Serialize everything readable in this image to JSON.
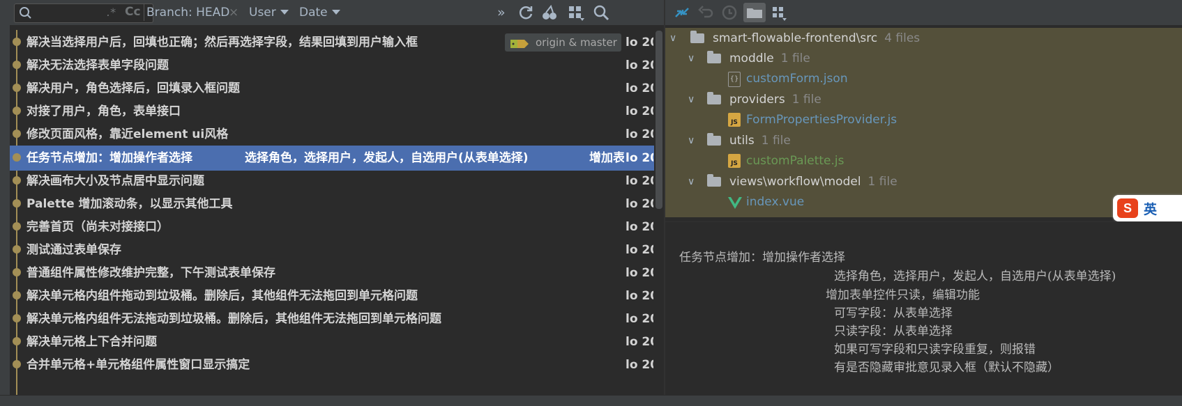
{
  "toolbar": {
    "search_placeholder": "",
    "regex_symbol": ".*",
    "case_symbol": "Cc",
    "branch_filter": "Branch: HEAD",
    "branch_clear": "×",
    "user_filter": "User",
    "date_filter": "Date",
    "more_symbol": "»"
  },
  "commits": [
    {
      "message": "解决当选择用户后，回填也正确；然后再选择字段，结果回填到用户输入框",
      "author": "lo 20",
      "ref": "origin & master"
    },
    {
      "message": "解决无法选择表单字段问题",
      "author": "lo 20"
    },
    {
      "message": "解决用户，角色选择后，回填录入框问题",
      "author": "lo 20"
    },
    {
      "message": "对接了用户，角色，表单接口",
      "author": "lo 20"
    },
    {
      "message": "修改页面风格，靠近element ui风格",
      "author": "lo 20"
    },
    {
      "message": "任务节点增加：增加操作者选择",
      "author": "lo 20",
      "selected": true,
      "extra1": "选择角色，选择用户，发起人，自选用户(从表单选择)",
      "extra2": "增加表"
    },
    {
      "message": "解决画布大小及节点居中显示问题",
      "author": "lo 20"
    },
    {
      "message": "Palette 增加滚动条，以显示其他工具",
      "author": "lo 20"
    },
    {
      "message": "完善首页（尚未对接接口）",
      "author": "lo 20"
    },
    {
      "message": "测试通过表单保存",
      "author": "lo 20"
    },
    {
      "message": "普通组件属性修改维护完整，下午测试表单保存",
      "author": "lo 20"
    },
    {
      "message": "解决单元格内组件拖动到垃圾桶。删除后，其他组件无法拖回到单元格问题",
      "author": "lo 20"
    },
    {
      "message": "解决单元格内组件无法拖动到垃圾桶。删除后，其他组件无法拖回到单元格问题",
      "author": "lo 20"
    },
    {
      "message": "解决单元格上下合并问题",
      "author": "lo 20"
    },
    {
      "message": "合并单元格+单元格组件属性窗口显示搞定",
      "author": "lo 20"
    }
  ],
  "tree": {
    "root": {
      "name": "smart-flowable-frontend\\src",
      "count": "4 files"
    },
    "folders": [
      {
        "name": "moddle",
        "count": "1 file",
        "file": "customForm.json"
      },
      {
        "name": "providers",
        "count": "1 file",
        "file": "FormPropertiesProvider.js"
      },
      {
        "name": "utils",
        "count": "1 file",
        "file": "customPalette.js"
      },
      {
        "name": "views\\workflow\\model",
        "count": "1 file",
        "file": "index.vue"
      }
    ]
  },
  "detail": {
    "lines": [
      "任务节点增加：增加操作者选择",
      "选择角色，选择用户，发起人，自选用户(从表单选择)",
      "增加表单控件只读，编辑功能",
      "可写字段：从表单选择",
      "只读字段：从表单选择",
      "如果可写字段和只读字段重复，则报错",
      "有是否隐藏审批意见录入框（默认不隐藏）"
    ]
  },
  "ime": {
    "label": "英"
  },
  "colors": {
    "background": "#2b2b2b",
    "toolbar": "#3c3f41",
    "selection": "#4b6eaf",
    "graph": "#a38f56",
    "tree_bg": "#54503a"
  }
}
